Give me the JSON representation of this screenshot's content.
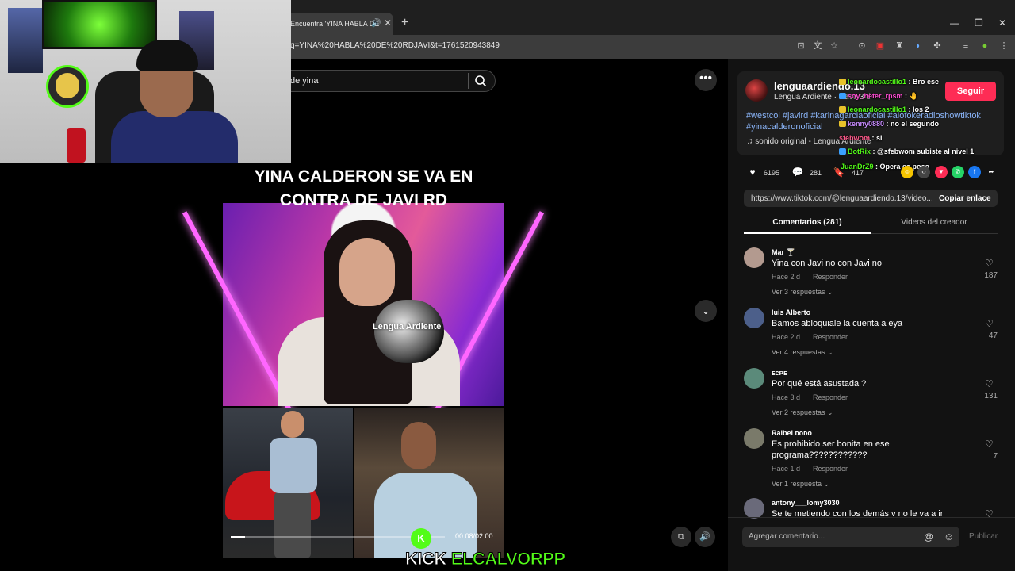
{
  "browser": {
    "tab_title": "Encuentra 'YINA HABLA DE",
    "tab_sound": "🔊",
    "tab_close": "✕",
    "new_tab": "+",
    "url": "q=YINA%20HABLA%20DE%20RDJAVI&t=1761520943849",
    "window": {
      "minimize": "—",
      "restore": "❐",
      "close": "✕"
    }
  },
  "search": {
    "text": "de yina"
  },
  "video": {
    "headline_line1": "YINA CALDERON SE VA EN",
    "headline_line2": "CONTRA DE JAVI RD",
    "brand_watermark": "Lengua Ardiente",
    "time": "00:08/02:00",
    "progress": 0.067,
    "kick_logo": "K"
  },
  "stream_overlay": {
    "platform": "KICK",
    "channel": "ELCALVORPP"
  },
  "controls": {
    "more": "•••",
    "next": "⌄",
    "pip": "⧉",
    "volume": "🔊"
  },
  "creator": {
    "name": "lenguaardiendo.13",
    "subtitle": "Lengua Ardiente · Hace 3 d",
    "follow": "Seguir",
    "hashtags": "#westcol #javird #karinagarciaoficial #alofokeradioshowtiktok #yinacalderonoficial",
    "sound": "♫  sonido original - Lengua Ardiente"
  },
  "chat": [
    {
      "user": "leonardocastillo1",
      "msg": ": Bro ese",
      "color": "#53fc18",
      "badge": "#e8c22a"
    },
    {
      "user": "soy_heter_rpsm",
      "msg": ": 🤚",
      "color": "#ff4dd2",
      "badge": "#3aa0ff"
    },
    {
      "user": "leonardocastillo1",
      "msg": ": los 2",
      "color": "#53fc18",
      "badge": "#e8c22a"
    },
    {
      "user": "kenny0880",
      "msg": ": no el segundo",
      "color": "#c88cff",
      "badge": "#e8c22a"
    },
    {
      "user": "sfebwom",
      "msg": ": si",
      "color": "#ff5a8c",
      "badge": ""
    },
    {
      "user": "BotRix",
      "msg": ": @sfebwom subiste al nivel 1",
      "color": "#53fc18",
      "badge": "#3aa0ff"
    },
    {
      "user": "JuanDrZ9",
      "msg": ": Opera es poco",
      "color": "#53fc18",
      "badge": ""
    }
  ],
  "stats": {
    "likes": "6195",
    "comments": "281",
    "saves": "417"
  },
  "share_icons": [
    {
      "name": "embed-icon",
      "glyph": "‹›",
      "color": "#444"
    },
    {
      "name": "send-icon",
      "glyph": "▼",
      "color": "#fe2c55"
    },
    {
      "name": "whatsapp-icon",
      "glyph": "✆",
      "color": "#25d366"
    },
    {
      "name": "facebook-icon",
      "glyph": "f",
      "color": "#1877f2"
    },
    {
      "name": "share-icon",
      "glyph": "➦",
      "color": "transparent"
    }
  ],
  "link": {
    "url": "https://www.tiktok.com/@lenguaardiendo.13/video...",
    "copy": "Copiar enlace"
  },
  "tabs": {
    "comments": "Comentarios (281)",
    "videos": "Videos del creador"
  },
  "comments": [
    {
      "user": "Mar 🍸",
      "text": "Yina con Javi no con Javi no",
      "meta": "Hace 2 d",
      "reply": "Responder",
      "more": "Ver 3 respuestas ⌄",
      "likes": "187",
      "avatar": "#b39a8f"
    },
    {
      "user": "luis Alberto",
      "text": "Bamos abloquiale la cuenta a eya",
      "meta": "Hace 2 d",
      "reply": "Responder",
      "more": "Ver 4 respuestas ⌄",
      "likes": "47",
      "avatar": "#4c5f8a"
    },
    {
      "user": "ᴇᴄᴘᴇ",
      "text": "Por qué está asustada ?",
      "meta": "Hace 3 d",
      "reply": "Responder",
      "more": "Ver 2 respuestas ⌄",
      "likes": "131",
      "avatar": "#5b8a7a"
    },
    {
      "user": "Raibel ᴅᴏᴅᴏ",
      "text": "Es prohibido ser bonita en ese programa????????????",
      "meta": "Hace 1 d",
      "reply": "Responder",
      "more": "Ver 1 respuesta ⌄",
      "likes": "7",
      "avatar": "#7a7a6a"
    },
    {
      "user": "antony___lomy3030",
      "text": "Se te metiendo con los demás y no le va a ir bien",
      "meta": "",
      "reply": "",
      "more": "",
      "likes": "",
      "avatar": "#6a6a7a"
    }
  ],
  "comment_input": {
    "placeholder": "Agregar comentario...",
    "mention": "@",
    "emoji": "☺",
    "publish": "Publicar"
  }
}
